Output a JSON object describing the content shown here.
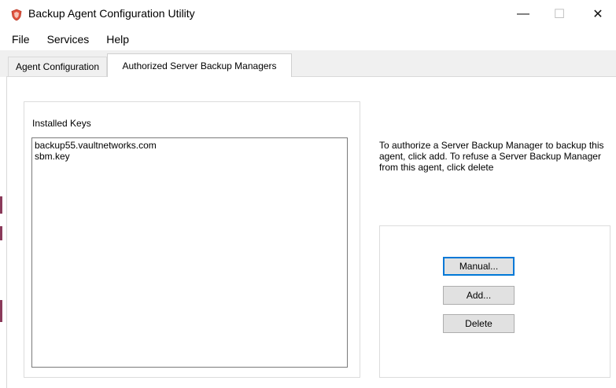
{
  "window": {
    "title": "Backup Agent Configuration Utility",
    "controls": {
      "minimize": "—",
      "maximize": "☐",
      "close": "✕"
    }
  },
  "menu": [
    "File",
    "Services",
    "Help"
  ],
  "tabs": [
    {
      "label": "Agent Configuration",
      "active": false
    },
    {
      "label": "Authorized Server Backup Managers",
      "active": true
    }
  ],
  "installed_keys": {
    "label": "Installed Keys",
    "items": [
      "backup55.vaultnetworks.com",
      "sbm.key"
    ]
  },
  "description": "To authorize a Server Backup Manager to backup this agent, click add. To refuse a Server Backup Manager from this agent, click delete",
  "buttons": {
    "manual": "Manual...",
    "add": "Add...",
    "delete": "Delete"
  },
  "colors": {
    "accent": "#0078d7",
    "icon": "#d9534f"
  }
}
